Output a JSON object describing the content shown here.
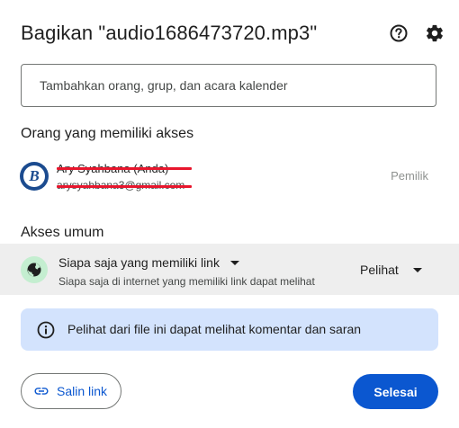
{
  "dialog": {
    "title": "Bagikan \"audio1686473720.mp3\"",
    "help_icon": "help-circle-icon",
    "settings_icon": "gear-icon"
  },
  "share_input": {
    "placeholder": "Tambahkan orang, grup, dan acara kalender",
    "value": ""
  },
  "people_section": {
    "heading": "Orang yang memiliki akses",
    "people": [
      {
        "name": "Ary Syahbana (Anda)",
        "email": "arysyahbana3@gmail.com",
        "role": "Pemilik",
        "avatar_letter": "B",
        "redacted": true
      }
    ]
  },
  "general_access": {
    "heading": "Akses umum",
    "icon": "globe-icon",
    "selected": "Siapa saja yang memiliki link",
    "description": "Siapa saja di internet yang memiliki link dapat melihat",
    "role": "Pelihat"
  },
  "info_banner": {
    "icon": "info-icon",
    "text": "Pelihat dari file ini dapat melihat komentar dan saran"
  },
  "footer": {
    "copy_link_label": "Salin link",
    "done_label": "Selesai"
  },
  "colors": {
    "primary": "#0b57d0",
    "info_bg": "#d3e3fd",
    "general_bg": "#eeeeee",
    "globe_bg": "#c4eed0",
    "redaction": "#e8162d"
  }
}
